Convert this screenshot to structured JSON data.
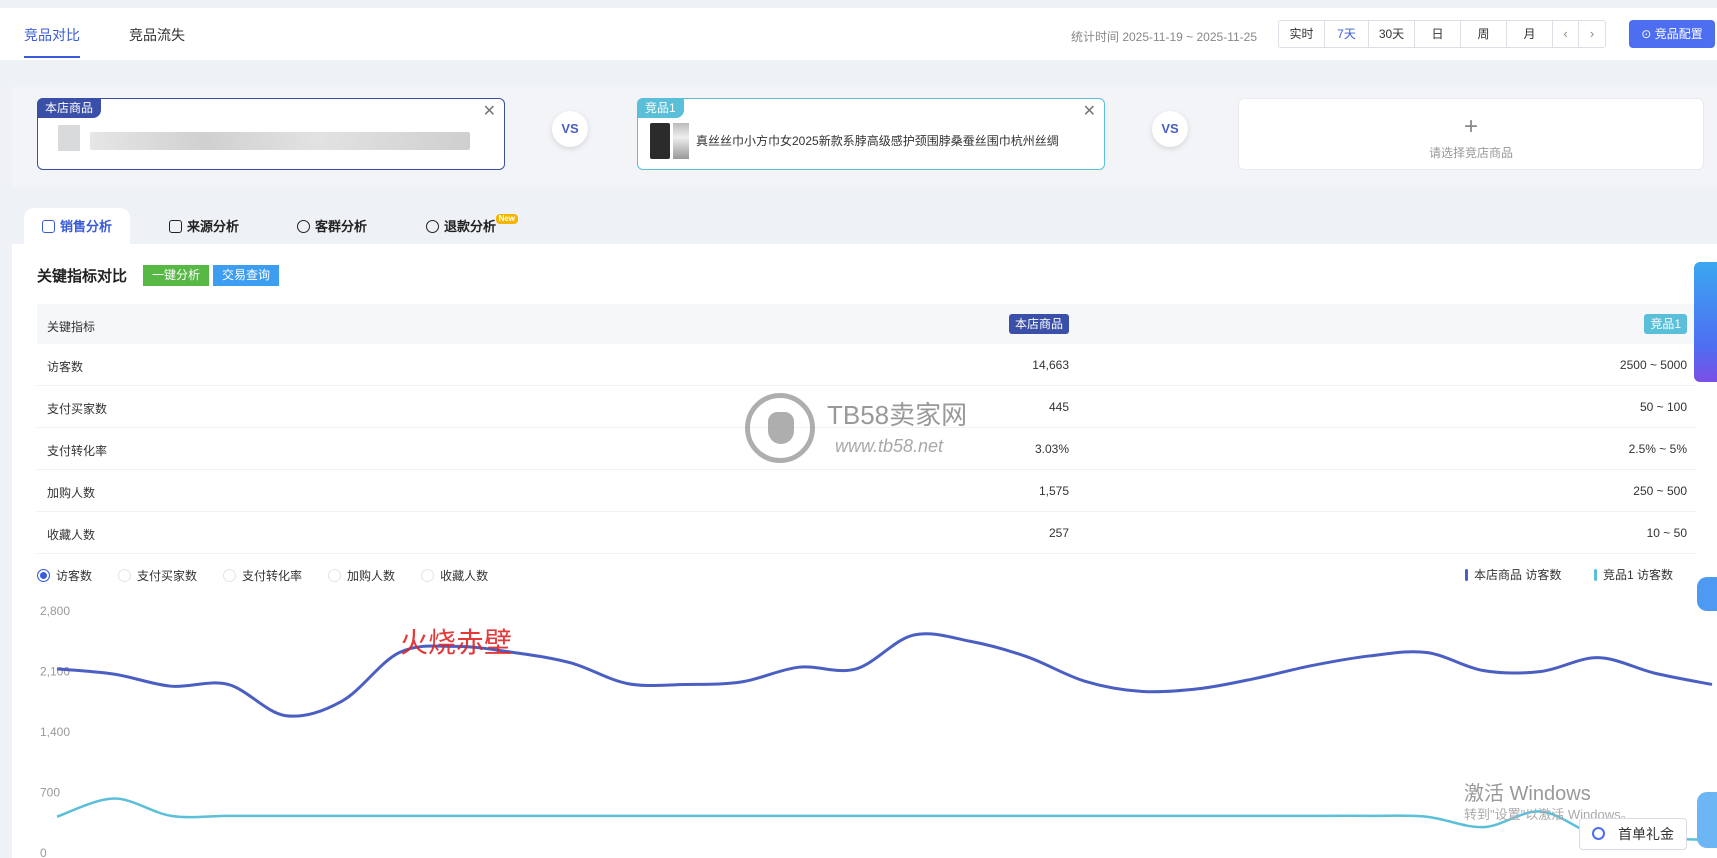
{
  "top_tabs": [
    {
      "label": "竞品对比",
      "active": true
    },
    {
      "label": "竞品流失",
      "active": false
    }
  ],
  "stat_time": "统计时间 2025-11-19 ~ 2025-11-25",
  "range_buttons": [
    "实时",
    "7天",
    "30天",
    "日",
    "周",
    "月"
  ],
  "range_active": "7天",
  "nav_prev": "‹",
  "nav_next": "›",
  "config_button": "竞品配置",
  "compare": {
    "own_tag": "本店商品",
    "comp_tag": "竞品1",
    "comp_title": "真丝丝巾小方巾女2025新款系脖高级感护颈围脖桑蚕丝围巾杭州丝绸",
    "vs_label": "VS",
    "empty_plus": "+",
    "empty_label": "请选择竞店商品",
    "close": "✕"
  },
  "sub_tabs": [
    {
      "label": "销售分析",
      "icon": "shopping-bag-icon",
      "active": true
    },
    {
      "label": "来源分析",
      "icon": "trend-icon",
      "active": false
    },
    {
      "label": "客群分析",
      "icon": "users-icon",
      "active": false
    },
    {
      "label": "退款分析",
      "icon": "refund-icon",
      "active": false,
      "badge": "New"
    }
  ],
  "section": {
    "title": "关键指标对比",
    "btn_analysis": "一键分析",
    "btn_trade": "交易查询"
  },
  "table": {
    "header": {
      "name": "关键指标",
      "own": "本店商品",
      "comp": "竞品1"
    },
    "rows": [
      {
        "name": "访客数",
        "own": "14,663",
        "comp": "2500 ~ 5000"
      },
      {
        "name": "支付买家数",
        "own": "445",
        "comp": "50 ~ 100"
      },
      {
        "name": "支付转化率",
        "own": "3.03%",
        "comp": "2.5% ~ 5%"
      },
      {
        "name": "加购人数",
        "own": "1,575",
        "comp": "250 ~ 500"
      },
      {
        "name": "收藏人数",
        "own": "257",
        "comp": "10 ~ 50"
      }
    ]
  },
  "metric_radios": [
    "访客数",
    "支付买家数",
    "支付转化率",
    "加购人数",
    "收藏人数"
  ],
  "metric_selected": "访客数",
  "legend": {
    "own": "本店商品 访客数",
    "comp": "竞品1 访客数",
    "own_color": "#4a5fc1",
    "comp_color": "#5bbfd9"
  },
  "chart_data": {
    "type": "line",
    "ylim": [
      0,
      2800
    ],
    "yticks": [
      "2,800",
      "2,100",
      "1,400",
      "700",
      "0"
    ],
    "grid": false,
    "legend_position": "top-right",
    "series": [
      {
        "name": "本店商品 访客数",
        "values": [
          2130,
          2070,
          1930,
          1950,
          1590,
          1760,
          2320,
          2390,
          2320,
          2200,
          1960,
          1950,
          1980,
          2150,
          2130,
          2520,
          2450,
          2270,
          1990,
          1870,
          1900,
          2020,
          2170,
          2280,
          2320,
          2110,
          2100,
          2260,
          2080,
          1950
        ]
      },
      {
        "name": "竞品1 访客数",
        "values": [
          420,
          630,
          430,
          430,
          430,
          430,
          430,
          430,
          430,
          430,
          430,
          430,
          430,
          430,
          430,
          430,
          430,
          430,
          430,
          430,
          430,
          430,
          430,
          430,
          420,
          300,
          480,
          200,
          170,
          150
        ]
      }
    ],
    "own_color": "#4a5fc1",
    "comp_color": "#5bbfd9"
  },
  "watermark": {
    "title": "TB58卖家网",
    "url": "www.tb58.net"
  },
  "overlay_red_text": "火烧赤壁",
  "windows_activation": {
    "line1": "激活 Windows",
    "line2": "转到\"设置\"以激活 Windows。"
  },
  "gift_button": "首单礼金"
}
